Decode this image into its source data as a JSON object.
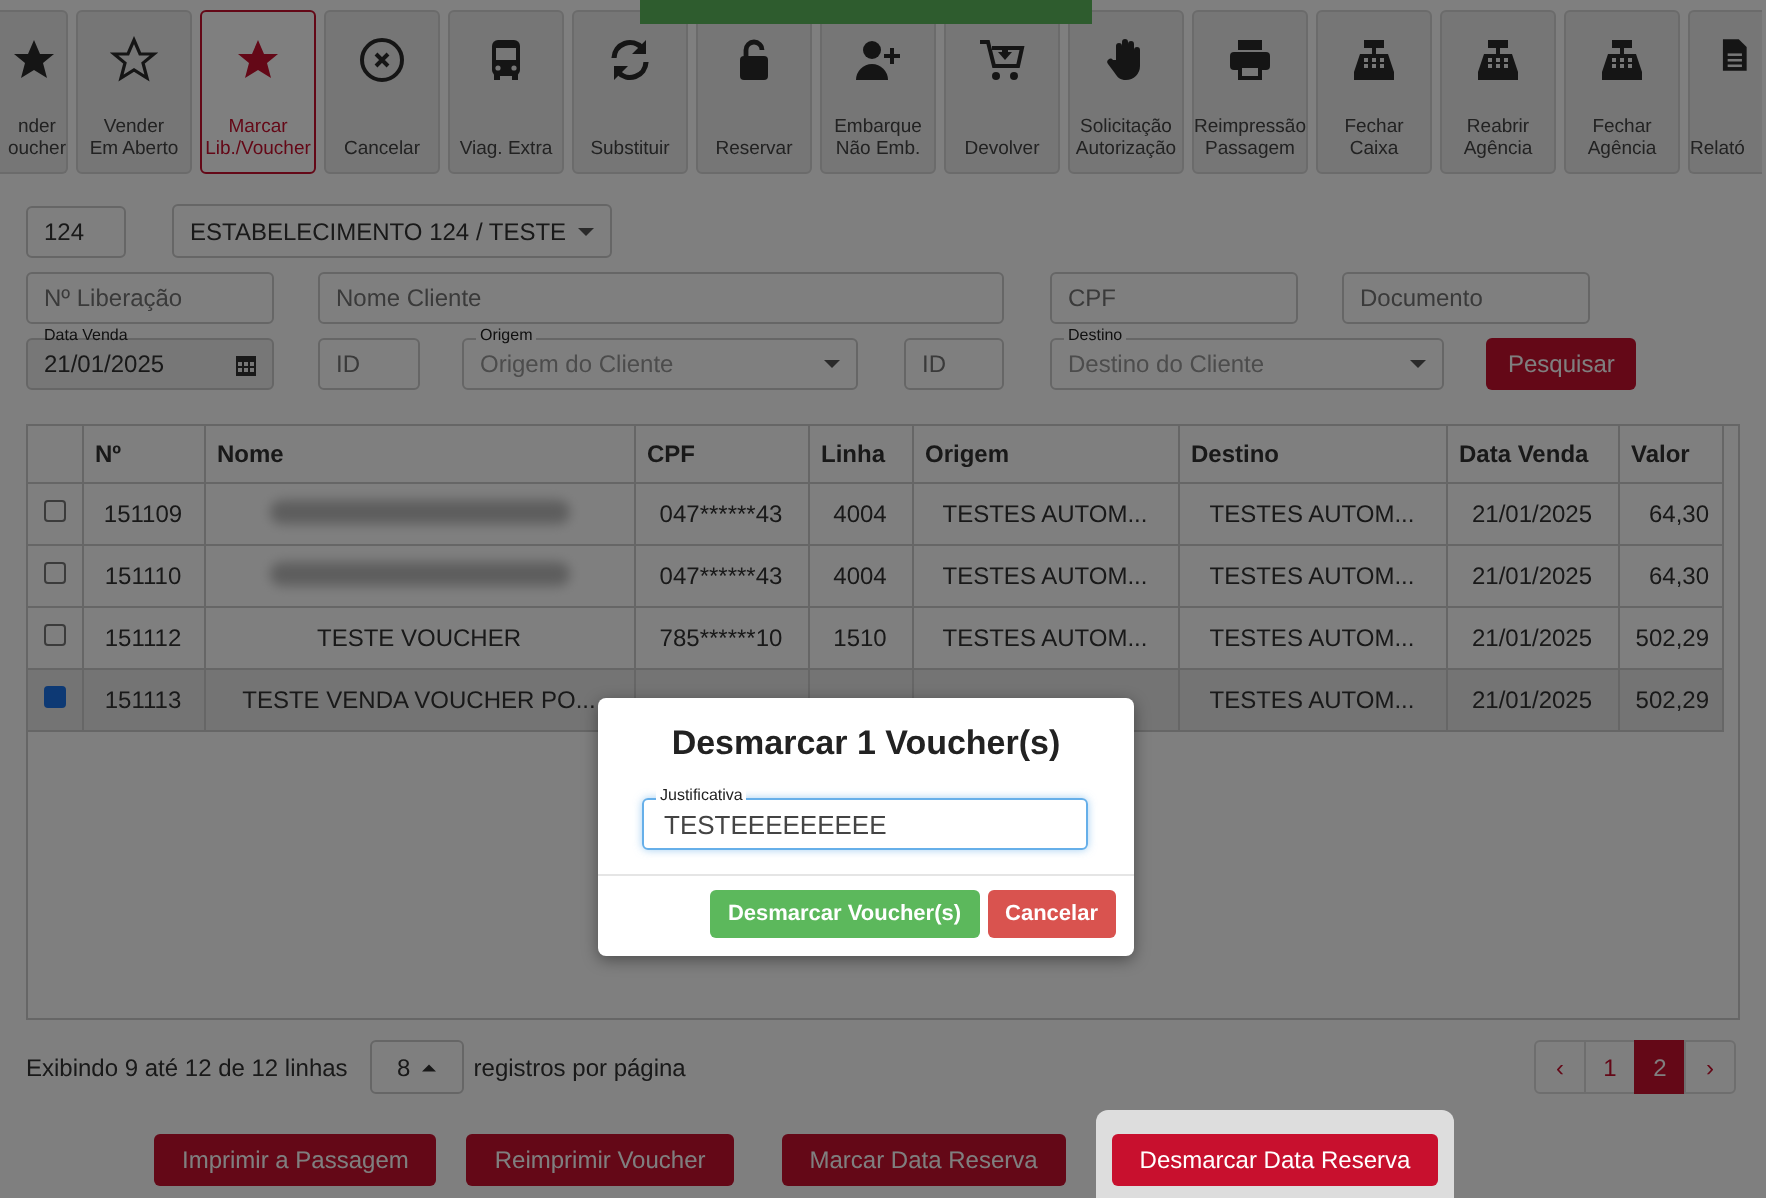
{
  "toolbar": [
    {
      "label": [
        "nder",
        "oucher"
      ],
      "selected": false
    },
    {
      "label": [
        "Vender",
        "Em Aberto"
      ],
      "selected": false
    },
    {
      "label": [
        "Marcar",
        "Lib./Voucher"
      ],
      "selected": true
    },
    {
      "label": [
        "Cancelar"
      ],
      "selected": false
    },
    {
      "label": [
        "Viag. Extra"
      ],
      "selected": false
    },
    {
      "label": [
        "Substituir"
      ],
      "selected": false
    },
    {
      "label": [
        "Reservar"
      ],
      "selected": false
    },
    {
      "label": [
        "Embarque",
        "Não Emb."
      ],
      "selected": false
    },
    {
      "label": [
        "Devolver"
      ],
      "selected": false
    },
    {
      "label": [
        "Solicitação",
        "Autorização"
      ],
      "selected": false
    },
    {
      "label": [
        "Reimpressão",
        "Passagem"
      ],
      "selected": false
    },
    {
      "label": [
        "Fechar",
        "Caixa"
      ],
      "selected": false
    },
    {
      "label": [
        "Reabrir",
        "Agência"
      ],
      "selected": false
    },
    {
      "label": [
        "Fechar",
        "Agência"
      ],
      "selected": false
    },
    {
      "label": [
        "Relató"
      ],
      "selected": false
    }
  ],
  "filters": {
    "agency_code": "124",
    "agency": "ESTABELECIMENTO 124 / TESTE",
    "release_number": {
      "placeholder": "Nº Liberação"
    },
    "client_name": {
      "placeholder": "Nome Cliente"
    },
    "cpf": {
      "placeholder": "CPF"
    },
    "document": {
      "placeholder": "Documento"
    },
    "sale_date": {
      "label": "Data Venda",
      "value": "21/01/2025"
    },
    "origin_id": {
      "placeholder": "ID"
    },
    "origin": {
      "label": "Origem",
      "placeholder": "Origem do Cliente"
    },
    "destination_id": {
      "placeholder": "ID"
    },
    "destination": {
      "label": "Destino",
      "placeholder": "Destino do Cliente"
    },
    "search_button": "Pesquisar"
  },
  "table": {
    "columns": [
      "Nº",
      "Nome",
      "CPF",
      "Linha",
      "Origem",
      "Destino",
      "Data Venda",
      "Valor"
    ],
    "rows": [
      {
        "checked": false,
        "blurred_name": true,
        "cells": [
          "151109",
          null,
          "047******43",
          "4004",
          "TESTES AUTOM...",
          "TESTES AUTOM...",
          "21/01/2025",
          "64,30"
        ]
      },
      {
        "checked": false,
        "blurred_name": true,
        "cells": [
          "151110",
          null,
          "047******43",
          "4004",
          "TESTES AUTOM...",
          "TESTES AUTOM...",
          "21/01/2025",
          "64,30"
        ]
      },
      {
        "checked": false,
        "cells": [
          "151112",
          "TESTE VOUCHER",
          "785******10",
          "1510",
          "TESTES AUTOM...",
          "TESTES AUTOM...",
          "21/01/2025",
          "502,29"
        ]
      },
      {
        "checked": true,
        "cells": [
          "151113",
          "TESTE VENDA VOUCHER PO...",
          null,
          null,
          null,
          "TESTES AUTOM...",
          "21/01/2025",
          "502,29"
        ]
      }
    ]
  },
  "footer": {
    "summary": "Exibindo 9 até 12 de 12 linhas",
    "page_size": "8",
    "page_size_suffix": "registros por página",
    "pagination": {
      "prev": "‹",
      "next": "›",
      "pages": [
        {
          "label": "1",
          "selected": false
        },
        {
          "label": "2",
          "selected": true
        }
      ]
    }
  },
  "actions": [
    {
      "label": "Imprimir a Passagem",
      "highlighted": false
    },
    {
      "label": "Reimprimir Voucher",
      "highlighted": false
    },
    {
      "label": "Marcar Data Reserva",
      "highlighted": false
    },
    {
      "label": "Desmarcar Data Reserva",
      "highlighted": true
    }
  ],
  "modal": {
    "title": "Desmarcar 1 Voucher(s)",
    "field_label": "Justificativa",
    "field_value": "TESTEEEEEEEEE",
    "confirm": "Desmarcar Voucher(s)",
    "cancel": "Cancelar"
  }
}
